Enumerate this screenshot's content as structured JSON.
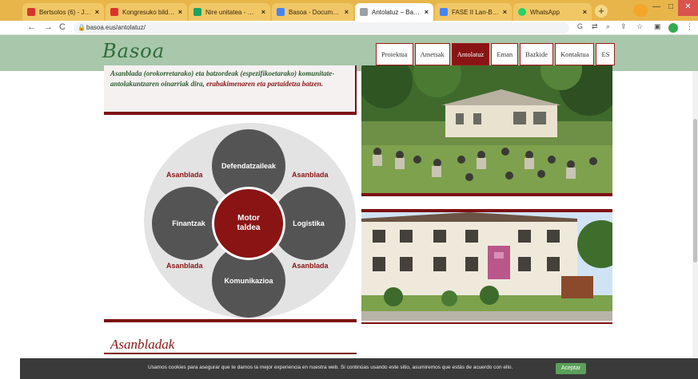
{
  "browser": {
    "tabs": [
      {
        "label": "Bertsolos (6) - Jose",
        "color": "#d9342b",
        "active": false
      },
      {
        "label": "Kongresuko bilduo",
        "color": "#d9342b",
        "active": false
      },
      {
        "label": "Nire unitatea - Google",
        "color": "#1ea362",
        "active": false
      },
      {
        "label": "Basoa - Documenti",
        "color": "#4285f4",
        "active": false
      },
      {
        "label": "Antolatuz – Basoa",
        "color": "#9aa0a6",
        "active": true
      },
      {
        "label": "FASE II Lan-Burua, c",
        "color": "#4285f4",
        "active": false
      },
      {
        "label": "WhatsApp",
        "color": "#25d366",
        "active": false
      }
    ],
    "new_tab": "+",
    "url": "basoa.eus/antolatuz/",
    "nav": {
      "back": "←",
      "forward": "→",
      "reload": "C"
    },
    "window": {
      "minimize": "—",
      "maximize": "□",
      "close": "✕"
    }
  },
  "site": {
    "logo": "Basoa",
    "nav": [
      {
        "label": "Proiektua",
        "active": false
      },
      {
        "label": "Ametsak",
        "active": false
      },
      {
        "label": "Antolatuz",
        "active": true
      },
      {
        "label": "Eman",
        "active": false
      },
      {
        "label": "Bazkide",
        "active": false
      },
      {
        "label": "Kontaktua",
        "active": false
      },
      {
        "label": "ES",
        "active": false
      }
    ],
    "intro": {
      "part1": "Asanblada (orokorretarako) eta batzordeak (espezifikoetarako) komunitate-antolakuntzaren oinarriak dira, ",
      "part2": "erabakimenaren eta partaidetza batzen."
    },
    "diagram": {
      "core": "Motor taldea",
      "nodes": {
        "top": "Defendatzaileak",
        "left": "Finantzak",
        "right": "Logistika",
        "bottom": "Komunikazioa"
      },
      "asanblada": "Asanblada"
    },
    "section_title": "Asanbladak",
    "photos": {
      "top_alt": "Bilera zuhaitzen artean",
      "bottom_alt": "Basoa etxea"
    }
  },
  "cookie": {
    "message": "Usamos cookies para asegurar que te damos la mejor experiencia en nuestra web. Si continúas usando este sitio, asumiremos que estás de acuerdo con ello.",
    "accept": "Aceptar"
  },
  "colors": {
    "brand_red": "#8a1414",
    "brand_green": "#2f6b38",
    "band": "#a8c7ab",
    "node_gray": "#545454"
  }
}
